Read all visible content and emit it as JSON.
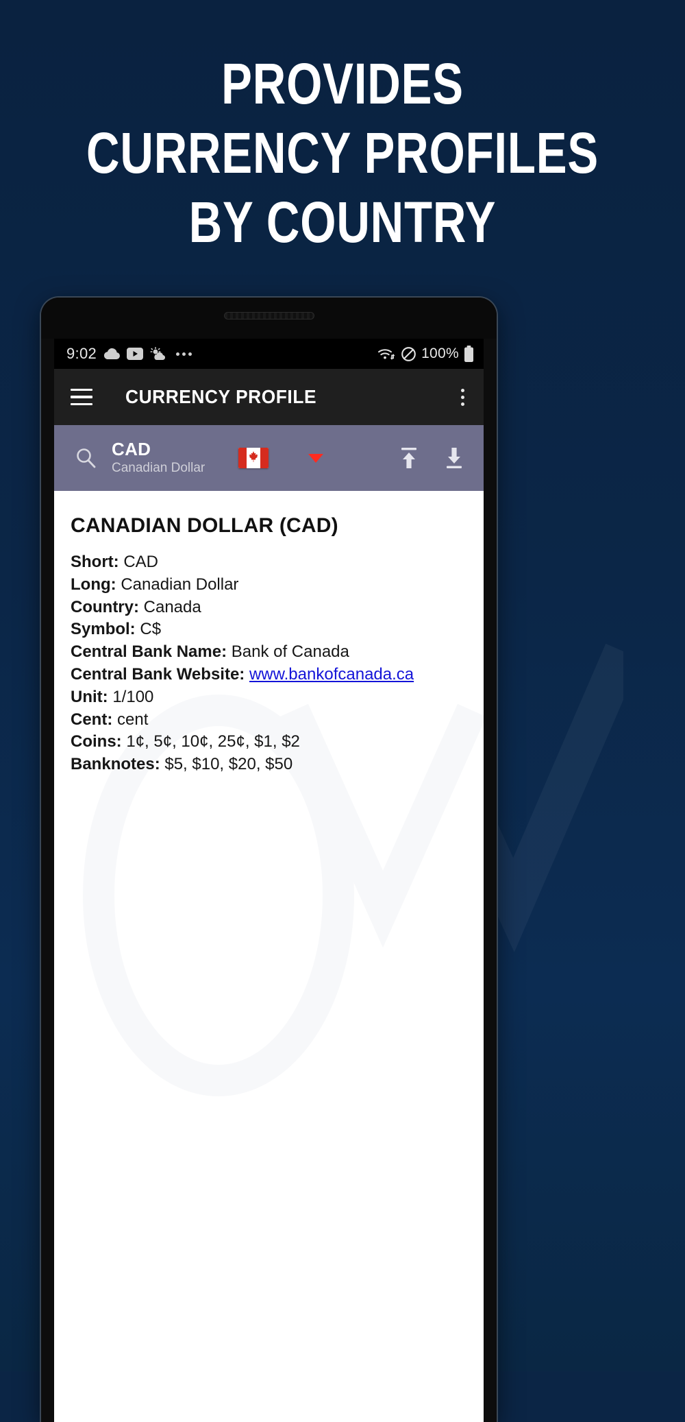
{
  "promo": {
    "headline_lines": [
      "PROVIDES",
      "CURRENCY PROFILES",
      "BY COUNTRY"
    ],
    "background_color": "#0b2545"
  },
  "phone": {
    "status_bar": {
      "clock": "9:02",
      "left_icons": [
        "cloud-icon",
        "youtube-icon",
        "weather-icon",
        "more-dots-icon"
      ],
      "wifi_icon": "wifi-icon",
      "dnd_icon": "do-not-disturb-icon",
      "battery_percent": "100%",
      "battery_icon": "battery-full-icon"
    },
    "app_bar": {
      "menu_icon": "hamburger-menu-icon",
      "title": "CURRENCY PROFILE",
      "overflow_icon": "kebab-menu-icon",
      "background_color": "#1f1f1f"
    },
    "toolbar": {
      "search_icon": "search-icon",
      "currency_code": "CAD",
      "currency_name": "Canadian Dollar",
      "flag_icon": "canada-flag-icon",
      "dropdown_icon": "caret-down-icon",
      "upload_icon": "upload-icon",
      "download_icon": "download-icon",
      "background_color": "#6e6e8c",
      "accent_color": "#ff2b20"
    },
    "profile": {
      "title": "CANADIAN DOLLAR (CAD)",
      "fields": [
        {
          "label": "Short:",
          "value": "CAD",
          "is_link": false
        },
        {
          "label": "Long:",
          "value": "Canadian Dollar",
          "is_link": false
        },
        {
          "label": "Country:",
          "value": "Canada",
          "is_link": false
        },
        {
          "label": "Symbol:",
          "value": "C$",
          "is_link": false
        },
        {
          "label": "Central Bank Name:",
          "value": "Bank of Canada",
          "is_link": false
        },
        {
          "label": "Central Bank Website:",
          "value": "www.bankofcanada.ca",
          "is_link": true
        },
        {
          "label": "Unit:",
          "value": "1/100",
          "is_link": false
        },
        {
          "label": "Cent:",
          "value": "cent",
          "is_link": false
        },
        {
          "label": "Coins:",
          "value": "1¢, 5¢, 10¢, 25¢, $1, $2",
          "is_link": false
        },
        {
          "label": "Banknotes:",
          "value": "$5, $10, $20, $50",
          "is_link": false
        }
      ],
      "link_color": "#1414d8"
    }
  }
}
